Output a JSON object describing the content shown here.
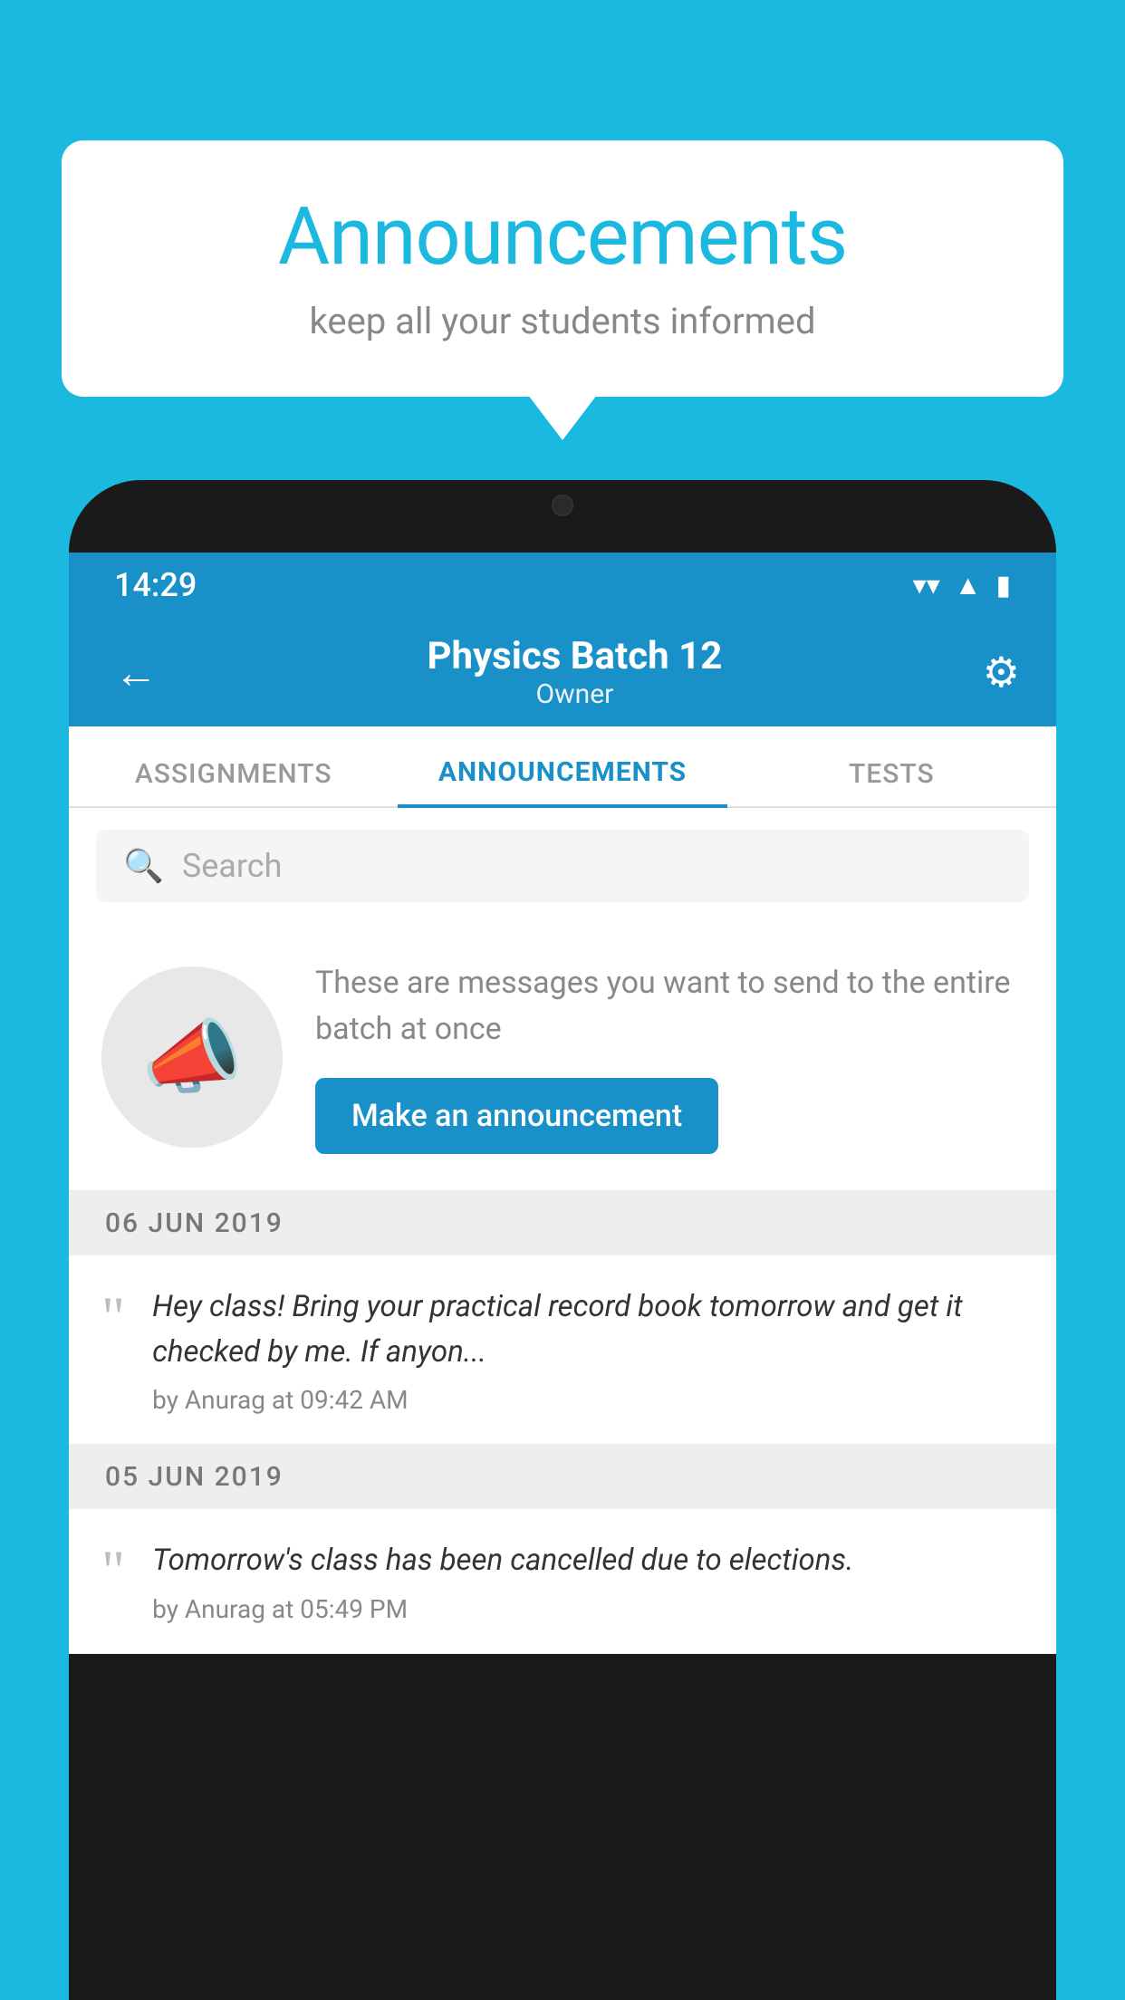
{
  "background_color": "#1BB8E0",
  "speech_bubble": {
    "title": "Announcements",
    "subtitle": "keep all your students informed"
  },
  "status_bar": {
    "time": "14:29",
    "icons": [
      "wifi",
      "signal",
      "battery"
    ]
  },
  "app_header": {
    "batch_name": "Physics Batch 12",
    "role": "Owner",
    "back_label": "←",
    "gear_label": "⚙"
  },
  "tabs": [
    {
      "label": "ASSIGNMENTS",
      "active": false
    },
    {
      "label": "ANNOUNCEMENTS",
      "active": true
    },
    {
      "label": "TESTS",
      "active": false
    }
  ],
  "search": {
    "placeholder": "Search"
  },
  "announce_promo": {
    "description": "These are messages you want to send to the entire batch at once",
    "button_label": "Make an announcement"
  },
  "date_groups": [
    {
      "date": "06  JUN  2019",
      "items": [
        {
          "message": "Hey class! Bring your practical record book tomorrow and get it checked by me. If anyon...",
          "author": "by Anurag at 09:42 AM"
        }
      ]
    },
    {
      "date": "05  JUN  2019",
      "items": [
        {
          "message": "Tomorrow's class has been cancelled due to elections.",
          "author": "by Anurag at 05:49 PM"
        }
      ]
    }
  ]
}
